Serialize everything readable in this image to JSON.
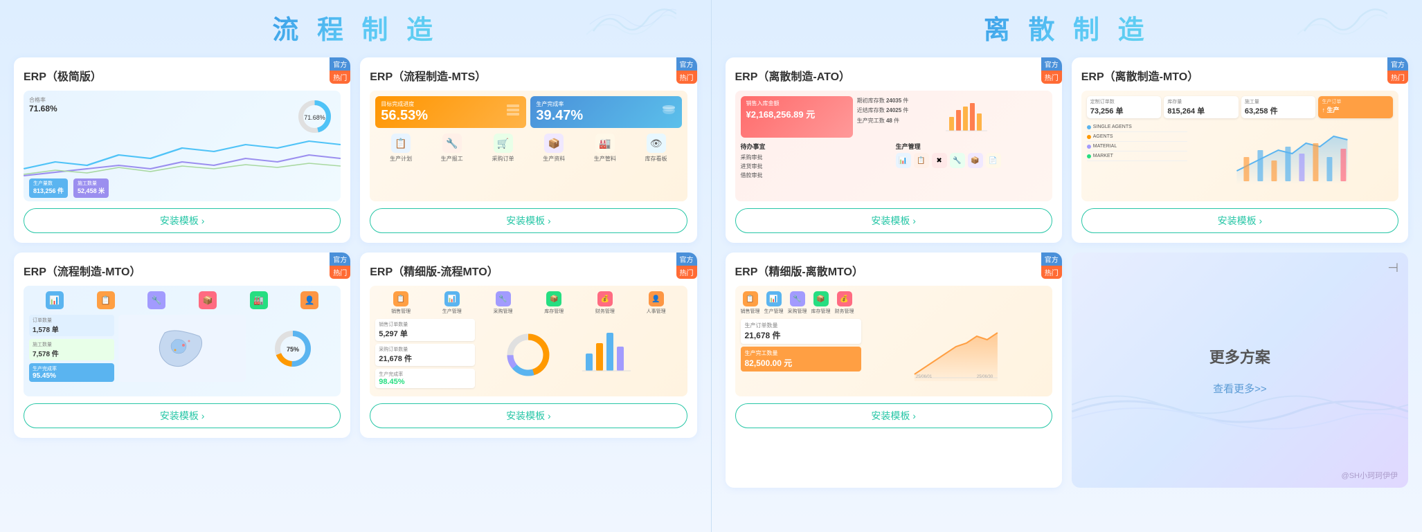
{
  "sections": [
    {
      "id": "liucheng",
      "title": "流 程 制 造",
      "cards": [
        {
          "id": "erp-jijian",
          "title": "ERP（极简版）",
          "badge_guan": "官方",
          "badge_hot": "热门",
          "install_btn": "安装模板  ›",
          "preview_type": "jijian",
          "stats": [
            "生产量数 813,256 件",
            "施工数量 52,458 米"
          ],
          "percent": "71.68%"
        },
        {
          "id": "erp-mts",
          "title": "ERP（流程制造-MTS）",
          "badge_guan": "官方",
          "badge_hot": "热门",
          "install_btn": "安装模板  ›",
          "preview_type": "mts",
          "rate1_label": "目标完成进度",
          "rate1_value": "56.53%",
          "rate2_label": "生产完成率",
          "rate2_value": "39.47%",
          "menu_items": [
            "生产计划",
            "生产报工",
            "采购订单",
            "生产资料",
            "生产管料",
            "库存看板"
          ]
        },
        {
          "id": "erp-mto-flow",
          "title": "ERP（流程制造-MTO）",
          "badge_guan": "官方",
          "badge_hot": "热门",
          "install_btn": "安装模板  ›",
          "preview_type": "mto-l"
        },
        {
          "id": "erp-fine-mto",
          "title": "ERP（精细版-流程MTO）",
          "badge_guan": "官方",
          "badge_hot": "热门",
          "install_btn": "安装模板  ›",
          "preview_type": "fine-mto",
          "stat1_label": "销售订单数量",
          "stat1_value": "5,297 单",
          "stat2_label": "采购订单数量",
          "stat2_value": "21,678 件",
          "stat3_label": "生产完成率",
          "stat3_value": "98.45%"
        }
      ]
    },
    {
      "id": "lisuan",
      "title": "离 散 制 造",
      "cards": [
        {
          "id": "erp-ato",
          "title": "ERP（离散制造-ATO）",
          "badge_guan": "官方",
          "badge_hot": "热门",
          "install_btn": "安装模板  ›",
          "preview_type": "ato",
          "revenue": "¥2,168,256.89 元",
          "stats": [
            "期初库存数 24035 件",
            "近结库存数 24025 件",
            "生产完工数 48 件"
          ],
          "todo_items": [
            "采购审批",
            "进货审批",
            "借款审批"
          ],
          "manage_title": "生产管理"
        },
        {
          "id": "erp-mto-r",
          "title": "ERP（离散制造-MTO）",
          "badge_guan": "官方",
          "badge_hot": "热门",
          "install_btn": "安装模板  ›",
          "preview_type": "mto-r",
          "stats": [
            "定制订单数 73,256 单",
            "库存量 815,264 单",
            "施工量 63,258 件",
            "生产订单"
          ],
          "list_items": [
            "SINGLE AGENTS",
            "AGENTS",
            "MATERIAL",
            "MARKET"
          ]
        },
        {
          "id": "erp-fine-dis",
          "title": "ERP（精细版-离散MTO）",
          "badge_guan": "官方",
          "badge_hot": "热门",
          "install_btn": "安装模板  ›",
          "preview_type": "fine-dis",
          "stat1_label": "生产订单数量",
          "stat1_value": "21,678 件",
          "stat2_label": "生产完工数量",
          "stat2_value": "82,500.00 元"
        },
        {
          "id": "more-solutions",
          "title": "更多方案",
          "is_more": true,
          "link_text": "查看更多>>",
          "exit_icon": "⊣"
        }
      ]
    }
  ],
  "watermark": "@SH小珂珂伊伊"
}
